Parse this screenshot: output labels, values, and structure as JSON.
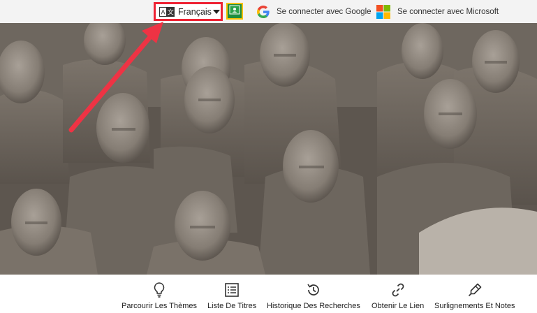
{
  "topbar": {
    "language": {
      "label": "Français",
      "icon": "translate-icon"
    },
    "classroom": {
      "icon": "google-classroom-icon"
    },
    "google_signin": {
      "label": "Se connecter avec Google",
      "icon": "google-logo-icon"
    },
    "microsoft_signin": {
      "label": "Se connecter avec Microsoft",
      "icon": "microsoft-logo-icon"
    }
  },
  "hero": {
    "subject": "terracotta-warriors-photo"
  },
  "bottom_nav": {
    "items": [
      {
        "label": "Parcourir Les Thèmes",
        "icon": "lightbulb-icon"
      },
      {
        "label": "Liste De Titres",
        "icon": "list-icon"
      },
      {
        "label": "Historique Des Recherches",
        "icon": "history-icon"
      },
      {
        "label": "Obtenir Le Lien",
        "icon": "link-icon"
      },
      {
        "label": "Surlignements Et Notes",
        "icon": "highlighter-icon"
      }
    ]
  },
  "colors": {
    "topbar_bg": "#f3f3f3",
    "highlight_red": "#ee2233",
    "classroom_green": "#1e8e3e",
    "classroom_border": "#f6c000"
  }
}
